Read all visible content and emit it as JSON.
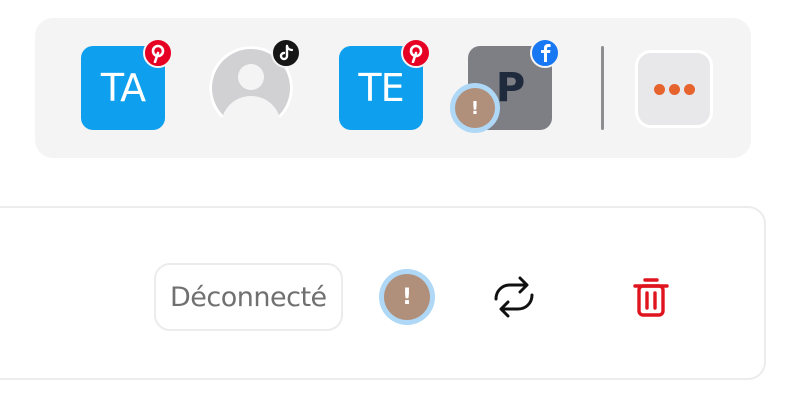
{
  "accounts": [
    {
      "initials": "TA",
      "network": "pinterest-icon"
    },
    {
      "initials": "",
      "network": "tiktok-icon"
    },
    {
      "initials": "TE",
      "network": "pinterest-icon"
    },
    {
      "initials": "P",
      "network": "facebook-icon",
      "warning": "!"
    }
  ],
  "more_button": {
    "icon": "more-dots-icon"
  },
  "connection": {
    "status_label": "Déconnecté",
    "warning_glyph": "!",
    "reconnect_icon": "refresh-icon",
    "delete_icon": "trash-icon"
  },
  "colors": {
    "tile_blue": "#0ea0ee",
    "pinterest": "#e60023",
    "facebook": "#1877f2",
    "accent_orange": "#e7632d",
    "danger_red": "#e0141e",
    "warning_brown": "#b08f7b",
    "warning_ring": "#aed8f6"
  }
}
